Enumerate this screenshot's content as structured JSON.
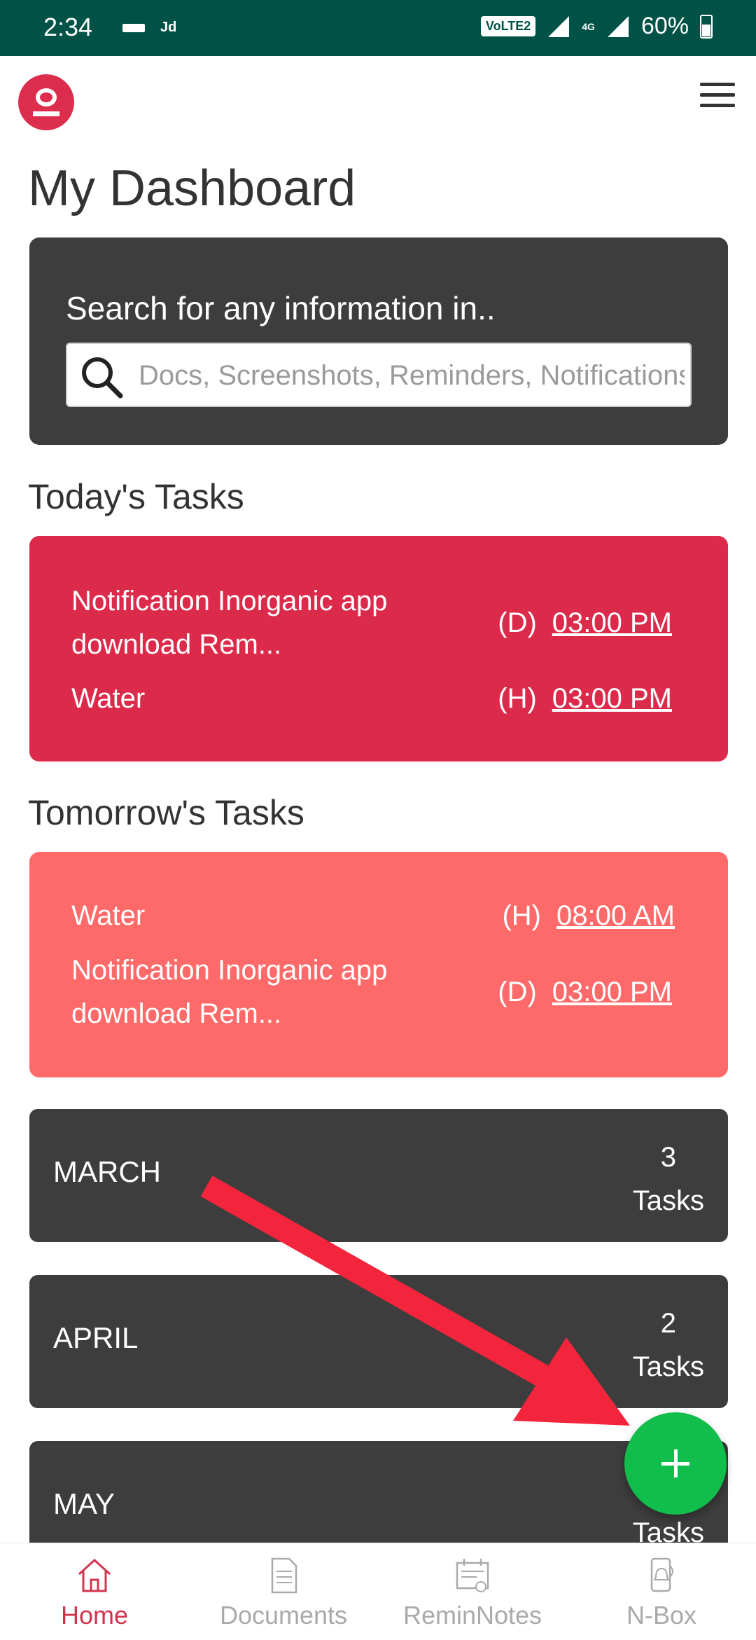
{
  "status_bar": {
    "time": "2:34",
    "carrier_text": "Jd",
    "network": "VoLTE2",
    "data_type": "4G",
    "battery": "60%"
  },
  "header": {
    "title": "My Dashboard"
  },
  "search": {
    "heading": "Search for any information in..",
    "placeholder": "Docs, Screenshots, Reminders, Notifications"
  },
  "today": {
    "title": "Today's Tasks",
    "tasks": [
      {
        "name": "Notification Inorganic app download Rem...",
        "tag": "(D)",
        "time": "03:00 PM"
      },
      {
        "name": "Water",
        "tag": "(H)",
        "time": "03:00 PM"
      }
    ]
  },
  "tomorrow": {
    "title": "Tomorrow's Tasks",
    "tasks": [
      {
        "name": "Water",
        "tag": "(H)",
        "time": "08:00 AM"
      },
      {
        "name": "Notification Inorganic app download Rem...",
        "tag": "(D)",
        "time": "03:00 PM"
      }
    ]
  },
  "months": [
    {
      "name": "MARCH",
      "count": "3",
      "unit": "Tasks"
    },
    {
      "name": "APRIL",
      "count": "2",
      "unit": "Tasks"
    },
    {
      "name": "MAY",
      "count": "",
      "unit": "Tasks"
    }
  ],
  "bottom_nav": {
    "items": [
      {
        "label": "Home",
        "icon": "home-icon"
      },
      {
        "label": "Documents",
        "icon": "document-icon"
      },
      {
        "label": "ReminNotes",
        "icon": "reminotes-icon"
      },
      {
        "label": "N-Box",
        "icon": "notification-box-icon"
      }
    ]
  },
  "colors": {
    "status_bar": "#005246",
    "accent": "#dc2e4c",
    "today_card": "#dc2a4b",
    "tomorrow_card": "#fe6a69",
    "dark_card": "#3d3d3d",
    "fab": "#11bd4b"
  }
}
